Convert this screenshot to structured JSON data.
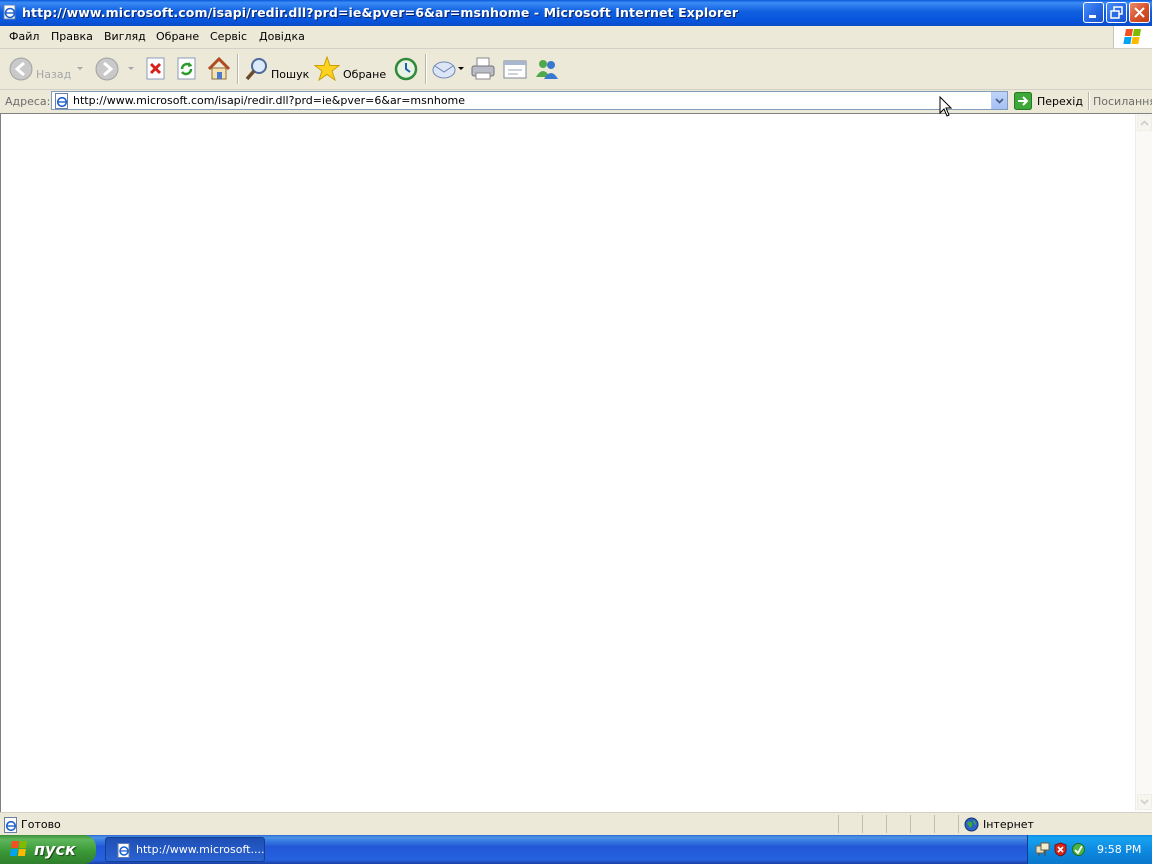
{
  "window": {
    "title": "http://www.microsoft.com/isapi/redir.dll?prd=ie&pver=6&ar=msnhome - Microsoft Internet Explorer",
    "controls": [
      "minimize-icon",
      "restore-icon",
      "close-icon"
    ]
  },
  "menu": {
    "items": [
      "Файл",
      "Правка",
      "Вигляд",
      "Обране",
      "Сервіс",
      "Довідка"
    ]
  },
  "toolbar": {
    "back_label": "Назад",
    "search_label": "Пошук",
    "favorites_label": "Обране",
    "icons": [
      "back-icon",
      "forward-icon",
      "stop-icon",
      "refresh-icon",
      "home-icon",
      "search-icon",
      "favorites-icon",
      "history-icon",
      "mail-icon",
      "print-icon",
      "edit-icon",
      "messenger-icon"
    ]
  },
  "address": {
    "label": "Адреса:",
    "url": "http://www.microsoft.com/isapi/redir.dll?prd=ie&pver=6&ar=msnhome",
    "go_label": "Перехід",
    "links_label": "Посилання"
  },
  "status": {
    "text": "Готово",
    "zone": "Інтернет"
  },
  "taskbar": {
    "start_label": "пуск",
    "task_label": "http://www.microsoft....",
    "clock": "9:58 PM"
  },
  "colors": {
    "titlebar": "#0A58DB",
    "chrome": "#ECE9D8",
    "taskbar": "#2157D7",
    "start": "#3C9A38",
    "tray": "#0E8BE2"
  }
}
